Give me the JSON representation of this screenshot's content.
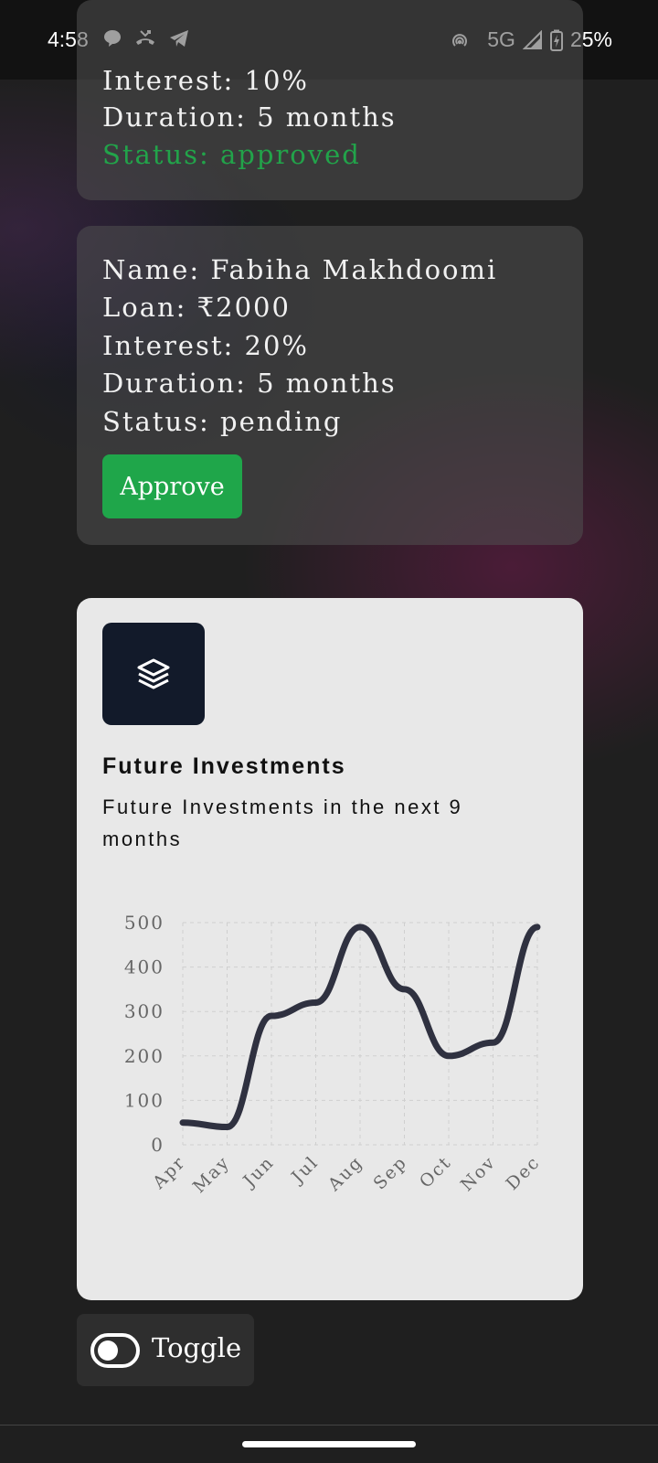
{
  "status_bar": {
    "time": "4:58",
    "network": "5G",
    "battery": "25%",
    "icons": [
      "chat-bubble-icon",
      "missed-call-icon",
      "telegram-icon",
      "hotspot-icon",
      "signal-icon",
      "battery-charging-icon"
    ]
  },
  "loans": [
    {
      "interest_line": "Interest: 10%",
      "duration_line": "Duration: 5 months",
      "status_line": "Status: approved"
    },
    {
      "name_line": "Name: Fabiha Makhdoomi",
      "loan_line": "Loan: ₹2000",
      "interest_line": "Interest: 20%",
      "duration_line": "Duration: 5 months",
      "status_line": "Status: pending",
      "approve_label": "Approve"
    }
  ],
  "investments": {
    "icon": "layers-icon",
    "title": "Future Investments",
    "subtitle": "Future Investments in the next 9 months"
  },
  "chart_data": {
    "type": "line",
    "categories": [
      "Apr",
      "May",
      "Jun",
      "Jul",
      "Aug",
      "Sep",
      "Oct",
      "Nov",
      "Dec"
    ],
    "series": [
      {
        "values": [
          50,
          40,
          290,
          320,
          490,
          350,
          200,
          230,
          490
        ]
      }
    ],
    "yticks": [
      "500",
      "400",
      "300",
      "200",
      "100",
      "0"
    ],
    "ylim": [
      0,
      500
    ],
    "grid": true,
    "line_color": "#2f3140"
  },
  "toggle": {
    "label": "Toggle"
  }
}
